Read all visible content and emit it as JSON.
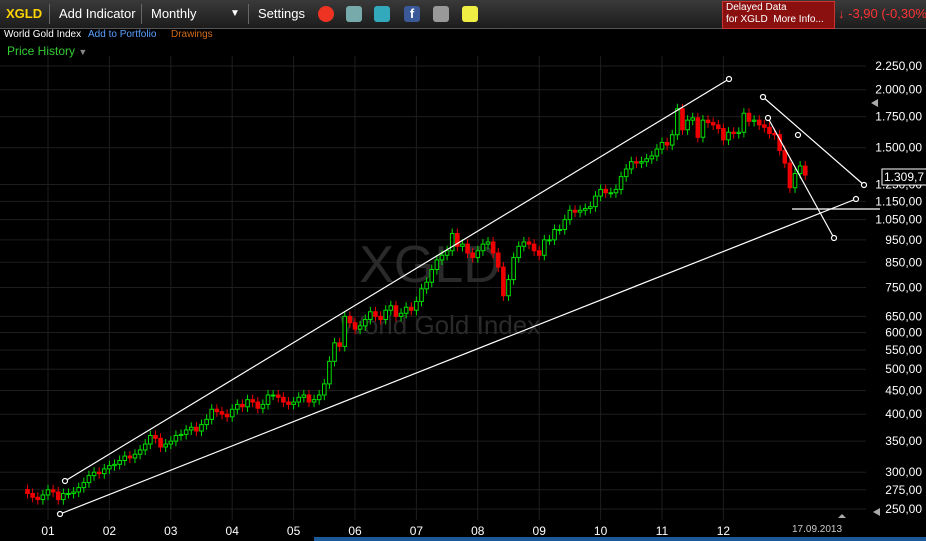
{
  "toolbar": {
    "symbol": "XGLD",
    "add_indicator": "Add Indicator",
    "period": "Monthly",
    "settings": "Settings",
    "delayed_line1": "Delayed Data",
    "delayed_line2": "for XGLD",
    "more_info": "More Info...",
    "change": "-3,90 (-0,30%)",
    "icons": [
      "alarm-clock-icon",
      "stack-icon",
      "twitter-icon",
      "facebook-icon",
      "camera-icon",
      "note-icon"
    ]
  },
  "subbar": {
    "name": "World Gold Index",
    "add_portfolio": "Add to Portfolio",
    "drawings": "Drawings",
    "price_history": "Price History"
  },
  "colors": {
    "up": "#00e000",
    "down": "#ee0000",
    "accent": "#ffd400",
    "link": "#5aa0ff",
    "drawings": "#d06a1a",
    "price_history": "#33cc33"
  },
  "chart_data": {
    "type": "candlestick",
    "title": "World Gold Index",
    "watermark": "XGLD",
    "y_scale": "log",
    "ylim": [
      235,
      2300
    ],
    "y_ticks": [
      "2.250,00",
      "2.000,00",
      "1.750,00",
      "1.500,00",
      "1.250,00",
      "1.150,00",
      "1.050,00",
      "950,00",
      "850,00",
      "750,00",
      "650,00",
      "600,00",
      "550,00",
      "500,00",
      "450,00",
      "400,00",
      "350,00",
      "300,00",
      "275,00",
      "250,00"
    ],
    "x_ticks": [
      "01",
      "02",
      "03",
      "04",
      "05",
      "06",
      "07",
      "08",
      "09",
      "10",
      "11",
      "12"
    ],
    "date_label": "17.09.2013",
    "last_value": "1.309,7",
    "monthly_close": [
      270,
      265,
      262,
      268,
      275,
      272,
      262,
      270,
      270,
      272,
      278,
      285,
      295,
      300,
      298,
      305,
      310,
      312,
      318,
      325,
      322,
      328,
      335,
      345,
      360,
      355,
      340,
      345,
      350,
      360,
      362,
      370,
      375,
      368,
      380,
      390,
      410,
      405,
      400,
      395,
      410,
      420,
      415,
      430,
      425,
      412,
      420,
      440,
      440,
      435,
      425,
      420,
      425,
      435,
      440,
      425,
      430,
      440,
      465,
      520,
      570,
      560,
      650,
      630,
      610,
      620,
      640,
      665,
      650,
      640,
      670,
      685,
      650,
      660,
      680,
      670,
      700,
      745,
      770,
      820,
      860,
      880,
      900,
      980,
      920,
      930,
      890,
      870,
      900,
      930,
      940,
      890,
      830,
      720,
      780,
      870,
      920,
      940,
      930,
      900,
      880,
      950,
      950,
      1000,
      1000,
      1050,
      1100,
      1090,
      1100,
      1110,
      1120,
      1180,
      1220,
      1200,
      1200,
      1220,
      1300,
      1350,
      1400,
      1390,
      1400,
      1420,
      1440,
      1490,
      1540,
      1520,
      1600,
      1820,
      1640,
      1720,
      1740,
      1580,
      1720,
      1700,
      1680,
      1650,
      1560,
      1620,
      1610,
      1620,
      1780,
      1710,
      1720,
      1680,
      1660,
      1610,
      1600,
      1480,
      1390,
      1230,
      1320,
      1370,
      1310
    ]
  }
}
